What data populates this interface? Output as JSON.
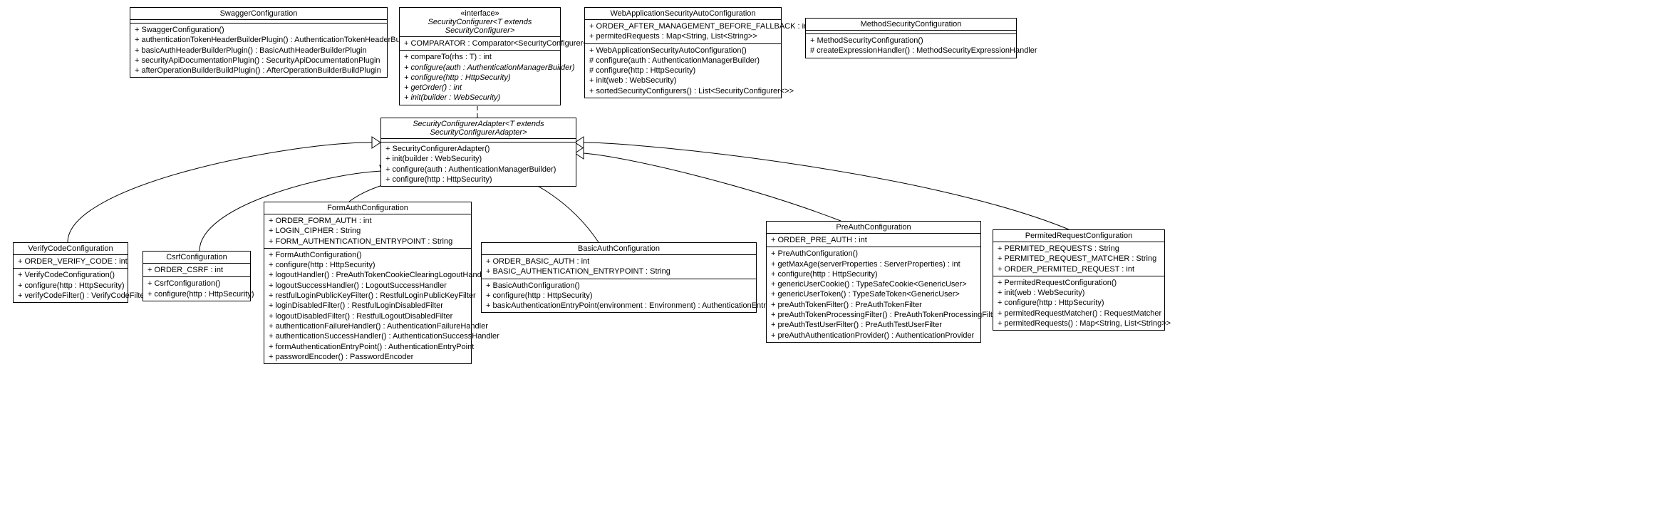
{
  "SwaggerConfiguration": {
    "name": "SwaggerConfiguration",
    "ops": [
      "+ SwaggerConfiguration()",
      "+ authenticationTokenHeaderBuilderPlugin() : AuthenticationTokenHeaderBuilderPlugin",
      "+ basicAuthHeaderBuilderPlugin() : BasicAuthHeaderBuilderPlugin",
      "+ securityApiDocumentationPlugin() : SecurityApiDocumentationPlugin",
      "+ afterOperationBuilderBuildPlugin() : AfterOperationBuilderBuildPlugin"
    ]
  },
  "SecurityConfigurer": {
    "stereo": "«interface»",
    "name": "SecurityConfigurer<T extends SecurityConfigurer>",
    "attrs": [
      "+ COMPARATOR : Comparator<SecurityConfigurer<>>"
    ],
    "ops": [
      "+ compareTo(rhs : T) : int",
      "+ configure(auth : AuthenticationManagerBuilder)",
      "+ configure(http : HttpSecurity)",
      "+ getOrder() : int",
      "+ init(builder : WebSecurity)"
    ]
  },
  "WebApplicationSecurityAutoConfiguration": {
    "name": "WebApplicationSecurityAutoConfiguration",
    "attrs": [
      "+ ORDER_AFTER_MANAGEMENT_BEFORE_FALLBACK : int",
      "+ permitedRequests : Map<String, List<String>>"
    ],
    "ops": [
      "+ WebApplicationSecurityAutoConfiguration()",
      "# configure(auth : AuthenticationManagerBuilder)",
      "# configure(http : HttpSecurity)",
      "+ init(web : WebSecurity)",
      "+ sortedSecurityConfigurers() : List<SecurityConfigurer<>>"
    ]
  },
  "MethodSecurityConfiguration": {
    "name": "MethodSecurityConfiguration",
    "ops": [
      "+ MethodSecurityConfiguration()",
      "# createExpressionHandler() : MethodSecurityExpressionHandler"
    ]
  },
  "SecurityConfigurerAdapter": {
    "name": "SecurityConfigurerAdapter<T extends SecurityConfigurerAdapter>",
    "ops": [
      "+ SecurityConfigurerAdapter()",
      "+ init(builder : WebSecurity)",
      "+ configure(auth : AuthenticationManagerBuilder)",
      "+ configure(http : HttpSecurity)"
    ]
  },
  "VerifyCodeConfiguration": {
    "name": "VerifyCodeConfiguration",
    "attrs": [
      "+ ORDER_VERIFY_CODE : int"
    ],
    "ops": [
      "+ VerifyCodeConfiguration()",
      "+ configure(http : HttpSecurity)",
      "+ verifyCodeFilter() : VerifyCodeFilter"
    ]
  },
  "CsrfConfiguration": {
    "name": "CsrfConfiguration",
    "attrs": [
      "+ ORDER_CSRF : int"
    ],
    "ops": [
      "+ CsrfConfiguration()",
      "+ configure(http : HttpSecurity)"
    ]
  },
  "FormAuthConfiguration": {
    "name": "FormAuthConfiguration",
    "attrs": [
      "+ ORDER_FORM_AUTH : int",
      "+ LOGIN_CIPHER : String",
      "+ FORM_AUTHENTICATION_ENTRYPOINT : String"
    ],
    "ops": [
      "+ FormAuthConfiguration()",
      "+ configure(http : HttpSecurity)",
      "+ logoutHandler() : PreAuthTokenCookieClearingLogoutHandler",
      "+ logoutSuccessHandler() : LogoutSuccessHandler",
      "+ restfulLoginPublicKeyFilter() : RestfulLoginPublicKeyFilter",
      "+ loginDisabledFilter() : RestfulLoginDisabledFilter",
      "+ logoutDisabledFilter() : RestfulLogoutDisabledFilter",
      "+ authenticationFailureHandler() : AuthenticationFailureHandler",
      "+ authenticationSuccessHandler() : AuthenticationSuccessHandler",
      "+ formAuthenticationEntryPoint() : AuthenticationEntryPoint",
      "+ passwordEncoder() : PasswordEncoder"
    ]
  },
  "BasicAuthConfiguration": {
    "name": "BasicAuthConfiguration",
    "attrs": [
      "+ ORDER_BASIC_AUTH : int",
      "+ BASIC_AUTHENTICATION_ENTRYPOINT : String"
    ],
    "ops": [
      "+ BasicAuthConfiguration()",
      "+ configure(http : HttpSecurity)",
      "+ basicAuthenticationEntryPoint(environment : Environment) : AuthenticationEntryPoint"
    ]
  },
  "PreAuthConfiguration": {
    "name": "PreAuthConfiguration",
    "attrs": [
      "+ ORDER_PRE_AUTH : int"
    ],
    "ops": [
      "+ PreAuthConfiguration()",
      "+ getMaxAge(serverProperties : ServerProperties) : int",
      "+ configure(http : HttpSecurity)",
      "+ genericUserCookie() : TypeSafeCookie<GenericUser>",
      "+ genericUserToken() : TypeSafeToken<GenericUser>",
      "+ preAuthTokenFilter() : PreAuthTokenFilter",
      "+ preAuthTokenProcessingFilter() : PreAuthTokenProcessingFilter",
      "+ preAuthTestUserFilter() : PreAuthTestUserFilter",
      "+ preAuthAuthenticationProvider() : AuthenticationProvider"
    ]
  },
  "PermitedRequestConfiguration": {
    "name": "PermitedRequestConfiguration",
    "attrs": [
      "+ PERMITED_REQUESTS : String",
      "+ PERMITED_REQUEST_MATCHER : String",
      "+ ORDER_PERMITED_REQUEST : int"
    ],
    "ops": [
      "+ PermitedRequestConfiguration()",
      "+ init(web : WebSecurity)",
      "+ configure(http : HttpSecurity)",
      "+ permitedRequestMatcher() : RequestMatcher",
      "+ permitedRequests() : Map<String, List<String>>"
    ]
  }
}
